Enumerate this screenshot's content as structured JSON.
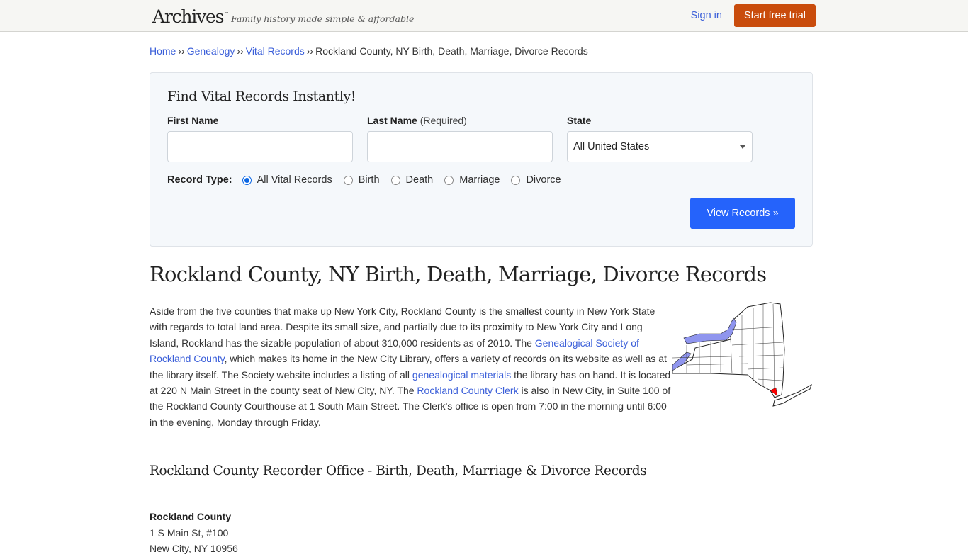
{
  "header": {
    "logo": "Archives",
    "logo_tm": "™",
    "tagline": "Family history made simple & affordable",
    "signin_label": "Sign in",
    "trial_label": "Start free trial"
  },
  "breadcrumb": {
    "items": [
      "Home",
      "Genealogy",
      "Vital Records"
    ],
    "separator": "››",
    "current": "Rockland County, NY Birth, Death, Marriage, Divorce Records"
  },
  "search": {
    "title": "Find Vital Records Instantly!",
    "first_name_label": "First Name",
    "first_name_value": "",
    "last_name_label": "Last Name",
    "last_name_required": "(Required)",
    "last_name_value": "",
    "state_label": "State",
    "state_selected": "All United States",
    "record_type_label": "Record Type:",
    "record_types": [
      "All Vital Records",
      "Birth",
      "Death",
      "Marriage",
      "Divorce"
    ],
    "record_type_selected": "All Vital Records",
    "submit_label": "View Records »"
  },
  "page": {
    "title": "Rockland County, NY Birth, Death, Marriage, Divorce Records",
    "intro": {
      "t1": "Aside from the five counties that make up New York City, Rockland County is the smallest county in New York State with regards to total land area. Despite its small size, and partially due to its proximity to New York City and Long Island, Rockland has the sizable population of about 310,000 residents as of 2010. The ",
      "link1": "Genealogical Society of Rockland County",
      "t2": ", which makes its home in the New City Library, offers a variety of records on its website as well as at the library itself. The Society website includes a listing of all ",
      "link2": "genealogical materials",
      "t3": " the library has on hand. It is located at 220 N Main Street in the county seat of New City, NY. The ",
      "link3": "Rockland County Clerk",
      "t4": " is also in New City, in Suite 100 of the Rockland County Courthouse at 1 South Main Street. The Clerk's office is open from 7:00 in the morning until 6:00 in the evening, Monday through Friday."
    },
    "map": {
      "alt": "New York State county map with Rockland County highlighted",
      "highlight_color": "#ff0000",
      "water_color": "#8f95ee"
    },
    "office_section_title": "Rockland County Recorder Office - Birth, Death, Marriage & Divorce Records",
    "office": {
      "name": "Rockland County",
      "address1": "1 S Main St, #100",
      "address2": "New City, NY 10956"
    }
  },
  "colors": {
    "link": "#3b5fd9",
    "trial_button": "#c94c0c",
    "primary_button": "#2563fb",
    "header_bg": "#f6f6f3",
    "panel_bg": "#f5f8fb"
  }
}
